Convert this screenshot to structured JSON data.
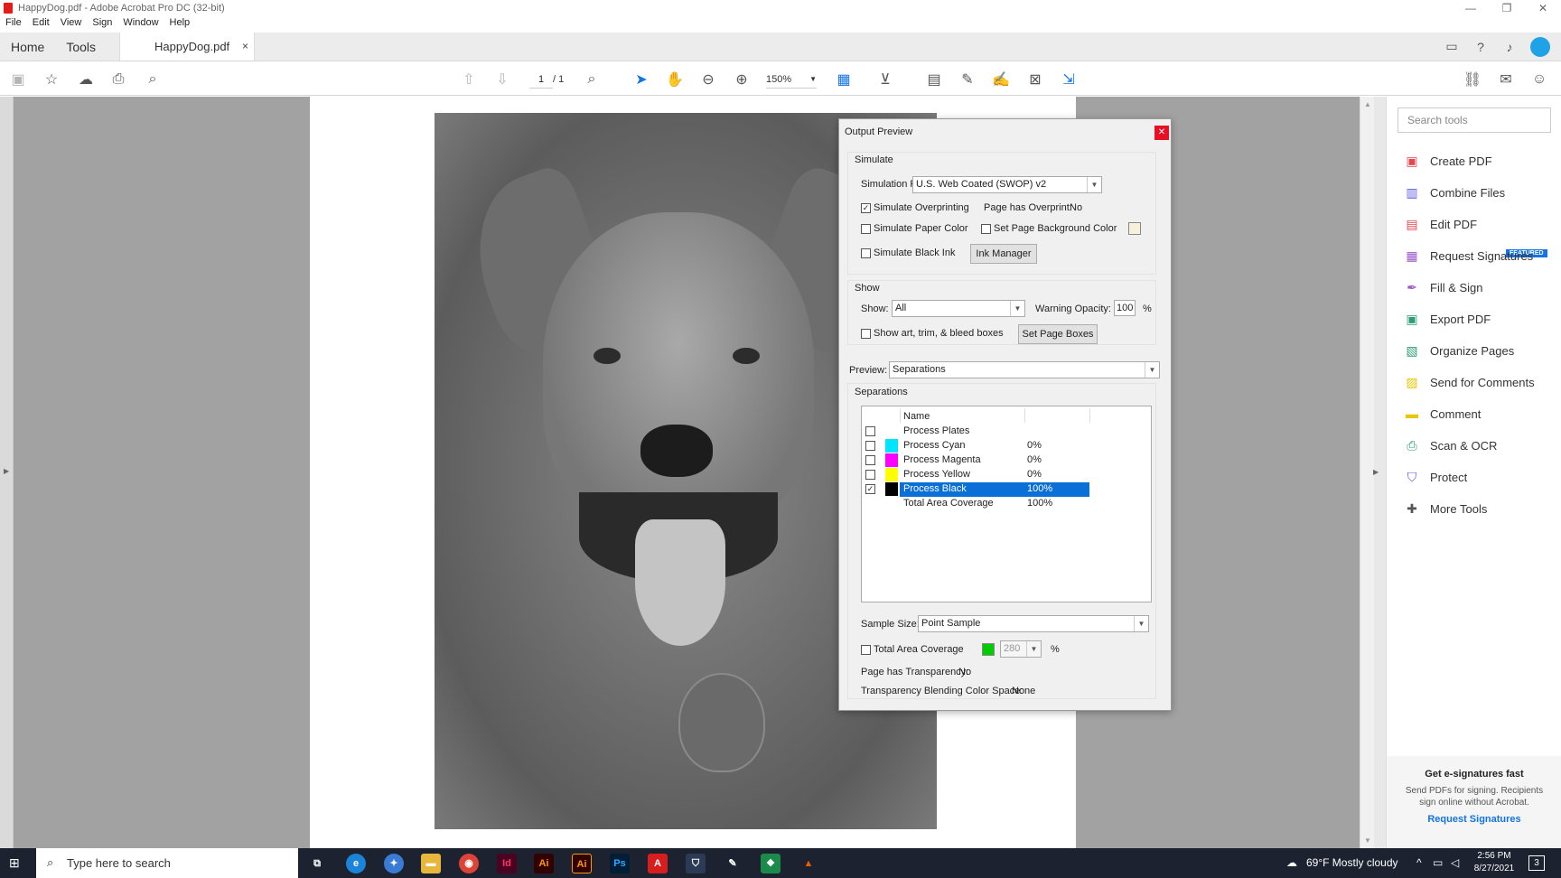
{
  "window": {
    "title": "HappyDog.pdf - Adobe Acrobat Pro DC (32-bit)",
    "minimize": "—",
    "maximize": "❐",
    "close": "✕"
  },
  "menu": [
    "File",
    "Edit",
    "View",
    "Sign",
    "Window",
    "Help"
  ],
  "tabs": {
    "home": "Home",
    "tools": "Tools",
    "doc": "HappyDog.pdf",
    "close": "×"
  },
  "toolbar": {
    "page_current": "1",
    "page_total": "/ 1",
    "zoom": "150%"
  },
  "tools_panel": {
    "search_placeholder": "Search tools",
    "items": [
      {
        "label": "Create PDF",
        "icon": "create-pdf-icon",
        "color": "#e34850"
      },
      {
        "label": "Combine Files",
        "icon": "combine-files-icon",
        "color": "#5c5ce0"
      },
      {
        "label": "Edit PDF",
        "icon": "edit-pdf-icon",
        "color": "#e34850"
      },
      {
        "label": "Request Signatures",
        "icon": "request-signatures-icon",
        "color": "#9b57c9"
      },
      {
        "label": "Fill & Sign",
        "icon": "fill-sign-icon",
        "color": "#9b57c9"
      },
      {
        "label": "Export PDF",
        "icon": "export-pdf-icon",
        "color": "#2d9d78"
      },
      {
        "label": "Organize Pages",
        "icon": "organize-pages-icon",
        "color": "#2d9d78"
      },
      {
        "label": "Send for Comments",
        "icon": "send-comments-icon",
        "color": "#e8c600"
      },
      {
        "label": "Comment",
        "icon": "comment-icon",
        "color": "#e8c600"
      },
      {
        "label": "Scan & OCR",
        "icon": "scan-ocr-icon",
        "color": "#2d9d78"
      },
      {
        "label": "Protect",
        "icon": "protect-icon",
        "color": "#5c5ce0"
      },
      {
        "label": "More Tools",
        "icon": "more-tools-icon",
        "color": "#555555"
      }
    ],
    "featured_badge": "FEATURED",
    "promo": {
      "heading": "Get e-signatures fast",
      "text": "Send PDFs for signing. Recipients sign online without Acrobat.",
      "link": "Request Signatures"
    }
  },
  "output_preview": {
    "title": "Output Preview",
    "simulate": {
      "label": "Simulate",
      "profile_label": "Simulation Profile:",
      "profile_value": "U.S. Web Coated (SWOP) v2",
      "overprinting": "Simulate Overprinting",
      "overprinting_checked": true,
      "page_overprint_label": "Page has Overprint:",
      "page_overprint_value": "No",
      "paper_color": "Simulate Paper Color",
      "page_bg_color": "Set Page Background Color",
      "black_ink": "Simulate Black Ink",
      "ink_manager": "Ink Manager"
    },
    "show": {
      "label": "Show",
      "show_label": "Show:",
      "show_value": "All",
      "warning_label": "Warning Opacity:",
      "warning_value": "100",
      "warning_unit": "%",
      "boxes_label": "Show art, trim, & bleed boxes",
      "set_boxes": "Set Page Boxes"
    },
    "preview": {
      "label": "Preview:",
      "value": "Separations"
    },
    "separations": {
      "label": "Separations",
      "name_header": "Name",
      "rows": [
        {
          "name": "Process Plates",
          "percent": "",
          "color": "",
          "checked": false
        },
        {
          "name": "Process Cyan",
          "percent": "0%",
          "color": "#00e5ff",
          "checked": false
        },
        {
          "name": "Process Magenta",
          "percent": "0%",
          "color": "#ff00ff",
          "checked": false
        },
        {
          "name": "Process Yellow",
          "percent": "0%",
          "color": "#ffff00",
          "checked": false
        },
        {
          "name": "Process Black",
          "percent": "100%",
          "color": "#000000",
          "checked": true
        },
        {
          "name": "Total Area Coverage",
          "percent": "100%",
          "color": "",
          "checked": false
        }
      ]
    },
    "sample_size_label": "Sample Size:",
    "sample_size_value": "Point Sample",
    "tac_label": "Total Area Coverage",
    "tac_value": "280",
    "tac_unit": "%",
    "tac_color": "#00cc00",
    "transparency_label": "Page has Transparency:",
    "transparency_value": "No",
    "blend_label": "Transparency Blending Color Space:",
    "blend_value": "None"
  },
  "taskbar": {
    "search_placeholder": "Type here to search",
    "weather": "69°F  Mostly cloudy",
    "time": "2:56 PM",
    "date": "8/27/2021",
    "notifications": "3",
    "apps": [
      {
        "name": "task-view",
        "label": "⧉",
        "color": "#1c2230"
      },
      {
        "name": "edge",
        "label": "e",
        "color": "#1b84d8"
      },
      {
        "name": "app-blue",
        "label": "✦",
        "color": "#3a7bd5"
      },
      {
        "name": "file-explorer",
        "label": "▬",
        "color": "#e8b63c"
      },
      {
        "name": "chrome",
        "label": "◉",
        "color": "#db4437"
      },
      {
        "name": "indesign",
        "label": "Id",
        "color": "#49021f"
      },
      {
        "name": "illustrator",
        "label": "Ai",
        "color": "#330000"
      },
      {
        "name": "illustrator-2",
        "label": "Ai",
        "color": "#330000"
      },
      {
        "name": "photoshop",
        "label": "Ps",
        "color": "#001e36"
      },
      {
        "name": "acrobat",
        "label": "A",
        "color": "#d71d1d"
      },
      {
        "name": "app-shield",
        "label": "⛉",
        "color": "#2b3a55"
      },
      {
        "name": "app-tool",
        "label": "✎",
        "color": "#1c2230"
      },
      {
        "name": "app-green",
        "label": "❖",
        "color": "#1c8a4a"
      },
      {
        "name": "vlc",
        "label": "▲",
        "color": "#e85e00"
      }
    ]
  }
}
